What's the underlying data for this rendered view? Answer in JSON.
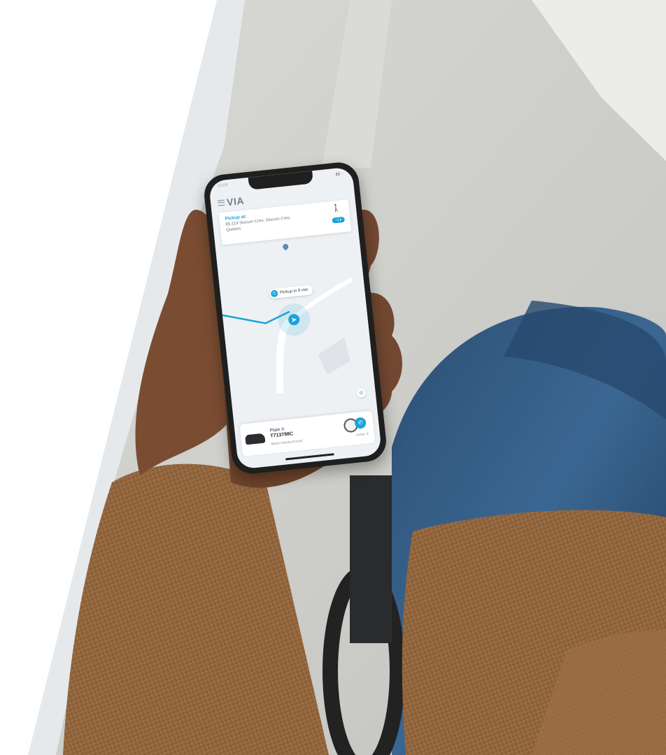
{
  "phone": {
    "status_time": "12:04",
    "app_logo": "VIA",
    "pickup_card": {
      "title": "Pickup at:",
      "address": "85-119 Slocum Cres, Slocum Cres, Queens",
      "walk_badge": "~1 ▸"
    },
    "eta_pill": "Pickup in 9 min",
    "vehicle_card": {
      "plate_label": "Plate #:",
      "plate_number": "T713798C",
      "car_model": "Black Honda Accord",
      "driver_name": "Vivian S"
    }
  },
  "icons": {
    "menu": "menu-icon",
    "pin": "location-pin-icon",
    "walk": "walking-person-icon",
    "clock": "clock-icon",
    "call": "phone-icon",
    "recenter": "recenter-icon"
  },
  "colors": {
    "accent": "#1ba3d8",
    "route": "#1ba3d8",
    "jacket": "#9a6c43",
    "jeans": "#2f5b84",
    "background": "#ffffff"
  }
}
